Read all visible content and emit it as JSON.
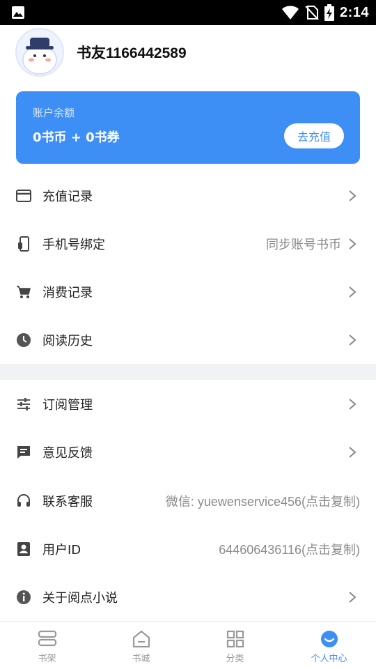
{
  "status_bar": {
    "time": "2:14"
  },
  "profile": {
    "username": "书友1166442589"
  },
  "balance": {
    "label": "账户余额",
    "amount": "0书币 + 0书券",
    "recharge_button": "去充值",
    "color": "#3d8ef5"
  },
  "menu_group1": [
    {
      "label": "充值记录",
      "icon": "card-icon",
      "value": "",
      "arrow": true
    },
    {
      "label": "手机号绑定",
      "icon": "phone-icon",
      "value": "同步账号书币",
      "arrow": true
    },
    {
      "label": "消费记录",
      "icon": "cart-icon",
      "value": "",
      "arrow": true
    },
    {
      "label": "阅读历史",
      "icon": "clock-icon",
      "value": "",
      "arrow": true
    }
  ],
  "menu_group2": [
    {
      "label": "订阅管理",
      "icon": "sliders-icon",
      "value": "",
      "arrow": true
    },
    {
      "label": "意见反馈",
      "icon": "feedback-icon",
      "value": "",
      "arrow": true
    },
    {
      "label": "联系客服",
      "icon": "headset-icon",
      "value": "微信: yuewenservice456(点击复制)",
      "arrow": false
    },
    {
      "label": "用户ID",
      "icon": "id-card-icon",
      "value": "644606436116(点击复制)",
      "arrow": false
    },
    {
      "label": "关于阅点小说",
      "icon": "info-icon",
      "value": "",
      "arrow": true
    }
  ],
  "tabs": [
    {
      "label": "书架",
      "icon": "bookshelf-icon",
      "active": false
    },
    {
      "label": "书城",
      "icon": "bookstore-icon",
      "active": false
    },
    {
      "label": "分类",
      "icon": "category-grid-icon",
      "active": false
    },
    {
      "label": "个人中心",
      "icon": "profile-smile-icon",
      "active": true
    }
  ],
  "accent_color": "#3d8ef5"
}
